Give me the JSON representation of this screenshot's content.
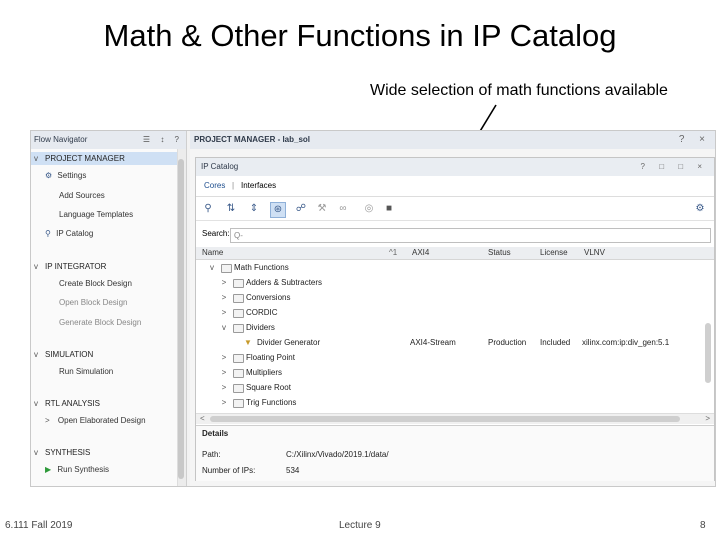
{
  "slide": {
    "title": "Math & Other Functions in IP Catalog",
    "annotation": "Wide selection of math functions available",
    "footer_left": "6.111 Fall 2019",
    "footer_center": "Lecture 9",
    "footer_right": "8"
  },
  "flow_navigator": {
    "title": "Flow Navigator",
    "controls": "☰ ↕ ?",
    "sections": [
      {
        "label": "PROJECT MANAGER",
        "items": [
          "Settings",
          "Add Sources",
          "Language Templates",
          "IP Catalog"
        ]
      },
      {
        "label": "IP INTEGRATOR",
        "items": [
          "Create Block Design",
          "Open Block Design",
          "Generate Block Design"
        ]
      },
      {
        "label": "SIMULATION",
        "items": [
          "Run Simulation"
        ]
      },
      {
        "label": "RTL ANALYSIS",
        "items": [
          "Open Elaborated Design"
        ]
      },
      {
        "label": "SYNTHESIS",
        "items": [
          "Run Synthesis"
        ]
      }
    ]
  },
  "project_manager": {
    "title": "PROJECT MANAGER - lab_sol",
    "controls": "? ×"
  },
  "ip_catalog": {
    "title": "IP Catalog",
    "controls": "? □ □ ×",
    "tabs": [
      "Cores",
      "Interfaces"
    ],
    "tab_separator": "|",
    "search_label": "Search:",
    "search_placeholder": "Q-",
    "columns": [
      "Name",
      "AXI4",
      "Status",
      "License",
      "VLNV"
    ],
    "sort_indicator": "^1",
    "rows": [
      {
        "indent": 1,
        "chevron": "v",
        "type": "folder",
        "name": "Math Functions",
        "axi": "",
        "status": "",
        "license": "",
        "vlnv": ""
      },
      {
        "indent": 2,
        "chevron": ">",
        "type": "folder",
        "name": "Adders & Subtracters",
        "axi": "",
        "status": "",
        "license": "",
        "vlnv": ""
      },
      {
        "indent": 2,
        "chevron": ">",
        "type": "folder",
        "name": "Conversions",
        "axi": "",
        "status": "",
        "license": "",
        "vlnv": ""
      },
      {
        "indent": 2,
        "chevron": ">",
        "type": "folder",
        "name": "CORDIC",
        "axi": "",
        "status": "",
        "license": "",
        "vlnv": ""
      },
      {
        "indent": 2,
        "chevron": "v",
        "type": "folder",
        "name": "Dividers",
        "axi": "",
        "status": "",
        "license": "",
        "vlnv": ""
      },
      {
        "indent": 3,
        "chevron": "",
        "type": "core",
        "name": "Divider Generator",
        "axi": "AXI4-Stream",
        "status": "Production",
        "license": "Included",
        "vlnv": "xilinx.com:ip:div_gen:5.1"
      },
      {
        "indent": 2,
        "chevron": ">",
        "type": "folder",
        "name": "Floating Point",
        "axi": "",
        "status": "",
        "license": "",
        "vlnv": ""
      },
      {
        "indent": 2,
        "chevron": ">",
        "type": "folder",
        "name": "Multipliers",
        "axi": "",
        "status": "",
        "license": "",
        "vlnv": ""
      },
      {
        "indent": 2,
        "chevron": ">",
        "type": "folder",
        "name": "Square Root",
        "axi": "",
        "status": "",
        "license": "",
        "vlnv": ""
      },
      {
        "indent": 2,
        "chevron": ">",
        "type": "folder",
        "name": "Trig Functions",
        "axi": "",
        "status": "",
        "license": "",
        "vlnv": ""
      }
    ],
    "details": {
      "title": "Details",
      "rows": [
        {
          "label": "Path:",
          "value": "C:/Xilinx/Vivado/2019.1/data/"
        },
        {
          "label": "Number of IPs:",
          "value": "534"
        }
      ]
    },
    "scroll_left": "<",
    "scroll_right": ">"
  }
}
